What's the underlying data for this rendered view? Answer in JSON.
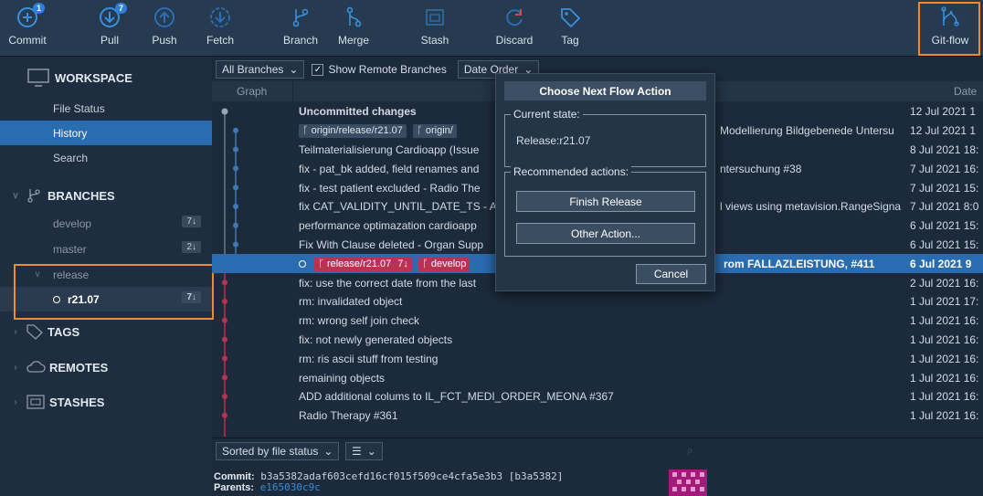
{
  "toolbar": {
    "commit": {
      "label": "Commit",
      "badge": "1"
    },
    "pull": {
      "label": "Pull",
      "badge": "7"
    },
    "push": {
      "label": "Push"
    },
    "fetch": {
      "label": "Fetch"
    },
    "branch": {
      "label": "Branch"
    },
    "merge": {
      "label": "Merge"
    },
    "stash": {
      "label": "Stash"
    },
    "discard": {
      "label": "Discard"
    },
    "tag": {
      "label": "Tag"
    },
    "gitflow": {
      "label": "Git-flow"
    }
  },
  "sidebar": {
    "workspace": "WORKSPACE",
    "file_status": "File Status",
    "history": "History",
    "search": "Search",
    "branches": "BRANCHES",
    "develop": {
      "label": "develop",
      "count": "7↓"
    },
    "master": {
      "label": "master",
      "count": "2↓"
    },
    "release": "release",
    "r2107": {
      "label": "r21.07",
      "count": "7↓"
    },
    "tags": "TAGS",
    "remotes": "REMOTES",
    "stashes": "STASHES"
  },
  "filters": {
    "branches": "All Branches",
    "show_remote": "Show Remote Branches",
    "order": "Date Order"
  },
  "columns": {
    "graph": "Graph",
    "date": "Date"
  },
  "commits": [
    {
      "msg": "Uncommitted changes",
      "tail": "",
      "date": "12 Jul 2021 1"
    },
    {
      "msg": "",
      "tail": "Modellierung Bildgebenede Untersu",
      "date": "12 Jul 2021 1"
    },
    {
      "msg": "Teilmaterialisierung Cardioapp (Issue",
      "tail": "",
      "date": "8 Jul 2021 18:"
    },
    {
      "msg": "fix - pat_bk added, field renames and",
      "tail": "ntersuchung #38",
      "date": "7 Jul 2021 16:"
    },
    {
      "msg": "fix - test patient excluded - Radio The",
      "tail": "",
      "date": "7 Jul 2021 15:"
    },
    {
      "msg": "fix CAT_VALIDITY_UNTIL_DATE_TS - A",
      "tail": "l views using metavision.RangeSigna",
      "date": "7 Jul 2021 8:0"
    },
    {
      "msg": "performance optimazation cardioapp",
      "tail": "",
      "date": "6 Jul 2021 15:"
    },
    {
      "msg": "Fix With Clause deleted - Organ Supp",
      "tail": "",
      "date": "6 Jul 2021 15:"
    },
    {
      "msg": "",
      "tail": "rom FALLAZLEISTUNG, #411",
      "date": "6 Jul 2021 9"
    },
    {
      "msg": "fix: use the correct date from the last",
      "tail": "",
      "date": "2 Jul 2021 16:"
    },
    {
      "msg": "rm: invalidated object",
      "tail": "",
      "date": "1 Jul 2021 17:"
    },
    {
      "msg": "rm: wrong self join check",
      "tail": "",
      "date": "1 Jul 2021 16:"
    },
    {
      "msg": "fix: not newly generated objects",
      "tail": "",
      "date": "1 Jul 2021 16:"
    },
    {
      "msg": "rm: ris ascii stuff from testing",
      "tail": "",
      "date": "1 Jul 2021 16:"
    },
    {
      "msg": "remaining objects",
      "tail": "",
      "date": "1 Jul 2021 16:"
    },
    {
      "msg": "ADD additional colums to IL_FCT_MEDI_ORDER_MEONA #367",
      "tail": "",
      "date": "1 Jul 2021 16:"
    },
    {
      "msg": "Radio Therapy #361",
      "tail": "",
      "date": "1 Jul 2021 16:"
    }
  ],
  "refs": {
    "origin_release": "origin/release/r21.07",
    "origin_short": "origin/",
    "release": "release/r21.07",
    "release_count": "7↓",
    "develop": "develop"
  },
  "bottom": {
    "sort": "Sorted by file status",
    "commit_label": "Commit:",
    "commit_hash": "b3a5382adaf603cefd16cf015f509ce4cfa5e3b3 [b3a5382]",
    "parents_label": "Parents:",
    "parents_hash": "e165030c9c"
  },
  "dialog": {
    "title": "Choose Next Flow Action",
    "current_legend": "Current state:",
    "current_value": "Release:r21.07",
    "recommended_legend": "Recommended actions:",
    "finish": "Finish Release",
    "other": "Other Action...",
    "cancel": "Cancel"
  },
  "colors": {
    "accent": "#2a6cb0",
    "highlight": "#f28a2c",
    "branch_red": "#b9324f",
    "branch_blue": "#3f78b3"
  }
}
